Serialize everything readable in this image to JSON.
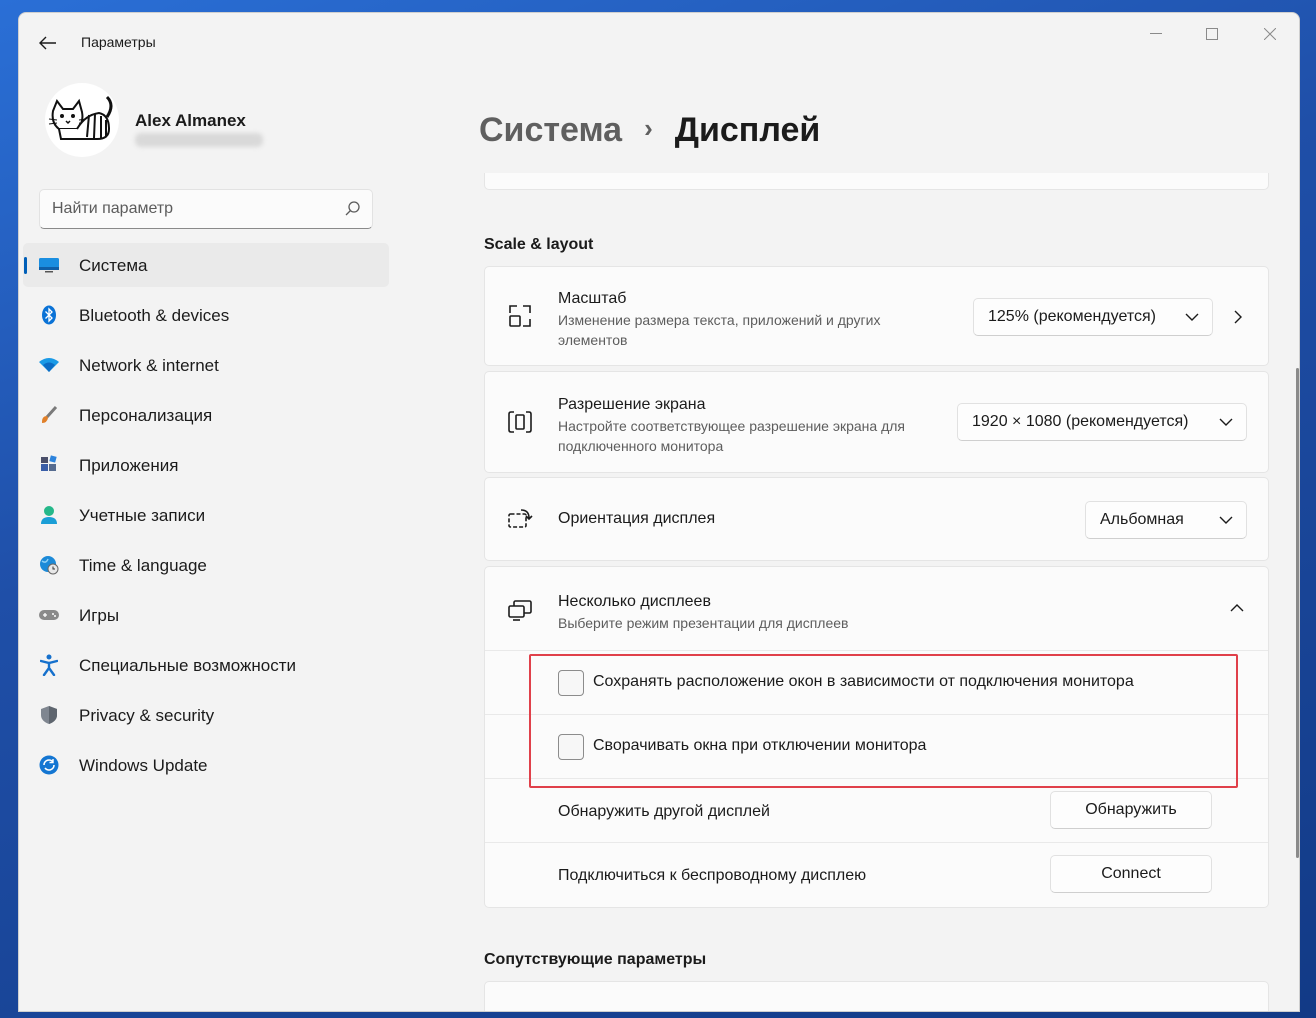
{
  "window": {
    "app_title": "Параметры",
    "controls": {
      "minimize_icon": "minimize-icon",
      "maximize_icon": "maximize-icon",
      "close_icon": "close-icon"
    }
  },
  "profile": {
    "name": "Alex Almanex"
  },
  "search": {
    "placeholder": "Найти параметр",
    "icon": "search-icon"
  },
  "sidebar": {
    "items": [
      {
        "label": "Система",
        "icon": "display-icon",
        "active": true
      },
      {
        "label": "Bluetooth & devices",
        "icon": "bluetooth-icon"
      },
      {
        "label": "Network & internet",
        "icon": "wifi-icon"
      },
      {
        "label": "Персонализация",
        "icon": "brush-icon"
      },
      {
        "label": "Приложения",
        "icon": "apps-icon"
      },
      {
        "label": "Учетные записи",
        "icon": "person-icon"
      },
      {
        "label": "Time & language",
        "icon": "globe-clock-icon"
      },
      {
        "label": "Игры",
        "icon": "gamepad-icon"
      },
      {
        "label": "Специальные возможности",
        "icon": "accessibility-icon"
      },
      {
        "label": "Privacy & security",
        "icon": "shield-icon"
      },
      {
        "label": "Windows Update",
        "icon": "update-icon"
      }
    ]
  },
  "breadcrumb": {
    "parent": "Система",
    "separator": "›",
    "current": "Дисплей"
  },
  "scale_layout": {
    "section_title": "Scale & layout",
    "scale": {
      "title": "Масштаб",
      "desc_line1": "Изменение размера текста, приложений и других",
      "desc_line2": "элементов",
      "value": "125% (рекомендуется)"
    },
    "resolution": {
      "title": "Разрешение экрана",
      "desc_line1": "Настройте соответствующее разрешение экрана для",
      "desc_line2": "подключенного монитора",
      "value": "1920 × 1080 (рекомендуется)"
    },
    "orientation": {
      "title": "Ориентация дисплея",
      "value": "Альбомная"
    },
    "multiple_displays": {
      "title": "Несколько дисплеев",
      "desc": "Выберите режим презентации для дисплеев",
      "expanded": true,
      "option1": {
        "label": "Сохранять расположение окон в зависимости от подключения монитора",
        "checked": false
      },
      "option2": {
        "label": "Сворачивать окна при отключении монитора",
        "checked": false
      },
      "detect": {
        "label": "Обнаружить другой дисплей",
        "button": "Обнаружить"
      },
      "wireless": {
        "label": "Подключиться к беспроводному дисплею",
        "button": "Connect"
      }
    }
  },
  "related": {
    "section_title": "Сопутствующие параметры"
  },
  "colors": {
    "accent": "#005fb8",
    "highlight_box": "#e0404a",
    "window_bg": "#f3f3f3",
    "card_bg": "#fbfbfb"
  }
}
